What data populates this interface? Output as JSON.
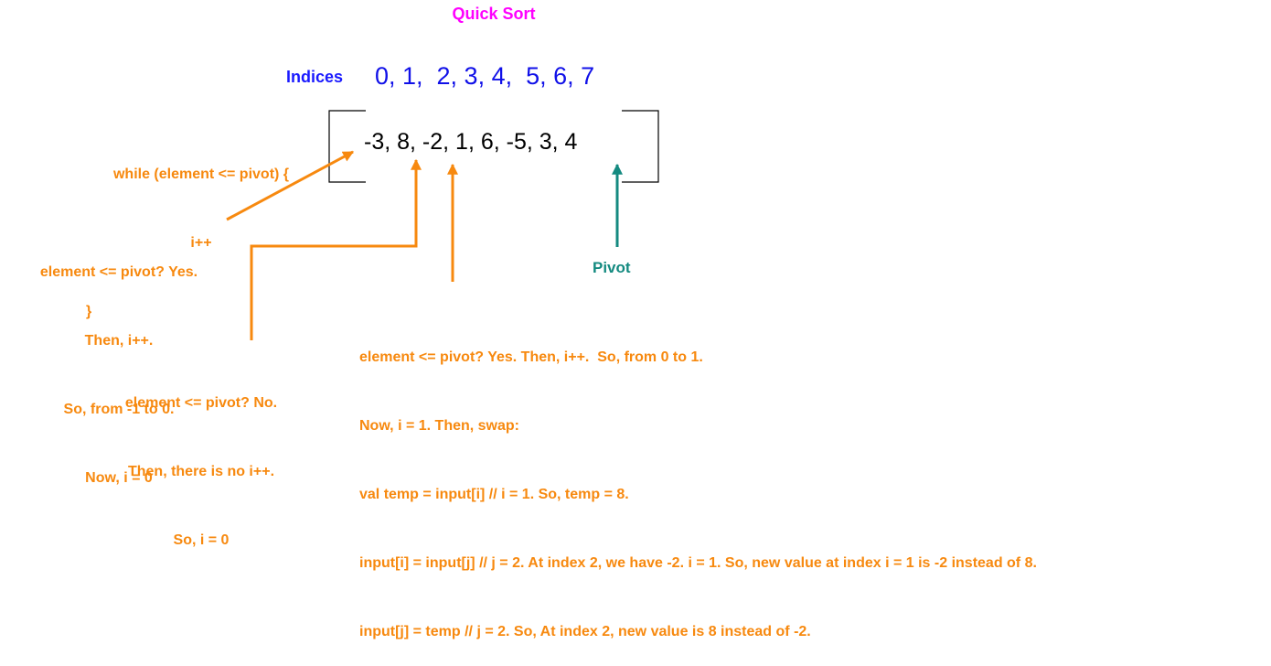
{
  "title": {
    "text": "Quick Sort",
    "color": "#ff00ff"
  },
  "indices": {
    "label": "Indices",
    "values": "0, 1,  2, 3, 4,  5, 6, 7",
    "label_color": "#1a1aff",
    "values_color": "#1010e8"
  },
  "array": {
    "values": "-3, 8, -2, 1, 6, -5, 3, 4"
  },
  "annotation_color": "#f7890f",
  "pivot_color": "#148a80",
  "notes": {
    "while_loop": [
      "while (element <= pivot) {",
      "i++",
      "}"
    ],
    "first_check": [
      "element <= pivot? Yes.",
      "Then, i++.",
      "So, from -1 to 0.",
      "Now, i = 0"
    ],
    "second_check": [
      "element <= pivot? No.",
      "Then, there is no i++.",
      "So, i = 0"
    ],
    "third_check": [
      "element <= pivot? Yes. Then, i++.  So, from 0 to 1.",
      "Now, i = 1. Then, swap:",
      "val temp = input[i] // i = 1. So, temp = 8.",
      "input[i] = input[j] // j = 2. At index 2, we have -2. i = 1. So, new value at index i = 1 is -2 instead of 8.",
      "input[j] = temp // j = 2. So, At index 2, new value is 8 instead of -2."
    ]
  },
  "pivot_label": "Pivot"
}
